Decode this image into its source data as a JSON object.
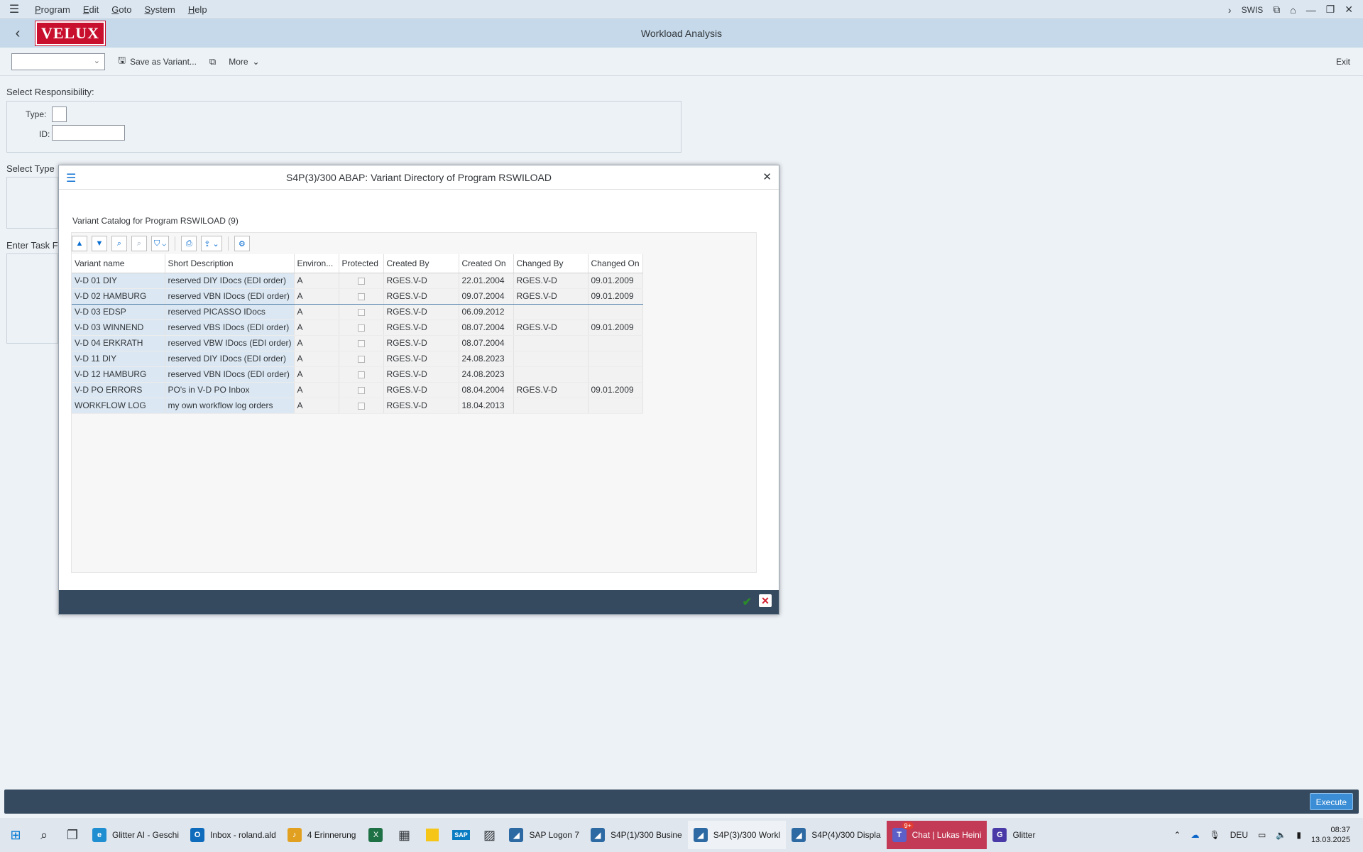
{
  "menubar": {
    "items": [
      "Program",
      "Edit",
      "Goto",
      "System",
      "Help"
    ],
    "system_id": "SWIS"
  },
  "titlebar": {
    "logo_text": "VELUX",
    "title": "Workload Analysis"
  },
  "toolbar": {
    "save_variant": "Save as Variant...",
    "more": "More",
    "exit": "Exit"
  },
  "main": {
    "select_responsibility": "Select Responsibility:",
    "type_label": "Type:",
    "id_label": "ID:",
    "select_type": "Select Type",
    "enter_task": "Enter Task F"
  },
  "dialog": {
    "title": "S4P(3)/300 ABAP: Variant Directory of Program RSWILOAD",
    "catalog_title": "Variant Catalog for Program RSWILOAD (9)",
    "columns": [
      "Variant name",
      "Short Description",
      "Environ...",
      "Protected",
      "Created By",
      "Created On",
      "Changed By",
      "Changed On"
    ],
    "rows": [
      {
        "name": "V-D 01 DIY",
        "desc": "reserved DIY IDocs (EDI order)",
        "env": "A",
        "created_by": "RGES.V-D",
        "created_on": "22.01.2004",
        "changed_by": "RGES.V-D",
        "changed_on": "09.01.2009"
      },
      {
        "name": "V-D 02 HAMBURG",
        "desc": "reserved VBN IDocs (EDI order)",
        "env": "A",
        "created_by": "RGES.V-D",
        "created_on": "09.07.2004",
        "changed_by": "RGES.V-D",
        "changed_on": "09.01.2009"
      },
      {
        "name": "V-D 03 EDSP",
        "desc": "reserved PICASSO IDocs",
        "env": "A",
        "created_by": "RGES.V-D",
        "created_on": "06.09.2012",
        "changed_by": "",
        "changed_on": ""
      },
      {
        "name": "V-D 03 WINNEND",
        "desc": "reserved VBS IDocs (EDI order)",
        "env": "A",
        "created_by": "RGES.V-D",
        "created_on": "08.07.2004",
        "changed_by": "RGES.V-D",
        "changed_on": "09.01.2009"
      },
      {
        "name": "V-D 04 ERKRATH",
        "desc": "reserved VBW IDocs (EDI order)",
        "env": "A",
        "created_by": "RGES.V-D",
        "created_on": "08.07.2004",
        "changed_by": "",
        "changed_on": ""
      },
      {
        "name": "V-D 11 DIY",
        "desc": "reserved DIY IDocs (EDI order)",
        "env": "A",
        "created_by": "RGES.V-D",
        "created_on": "24.08.2023",
        "changed_by": "",
        "changed_on": ""
      },
      {
        "name": "V-D 12 HAMBURG",
        "desc": "reserved VBN IDocs (EDI order)",
        "env": "A",
        "created_by": "RGES.V-D",
        "created_on": "24.08.2023",
        "changed_by": "",
        "changed_on": ""
      },
      {
        "name": "V-D PO ERRORS",
        "desc": "PO's in V-D PO Inbox",
        "env": "A",
        "created_by": "RGES.V-D",
        "created_on": "08.04.2004",
        "changed_by": "RGES.V-D",
        "changed_on": "09.01.2009"
      },
      {
        "name": "WORKFLOW LOG",
        "desc": "my own workflow log orders",
        "env": "A",
        "created_by": "RGES.V-D",
        "created_on": "18.04.2013",
        "changed_by": "",
        "changed_on": ""
      }
    ]
  },
  "statusbar": {
    "execute": "Execute"
  },
  "taskbar": {
    "apps": [
      {
        "label": "Glitter AI - Geschi",
        "icon": "edge-icon",
        "color": "#1f8fd1"
      },
      {
        "label": "Inbox - roland.ald",
        "icon": "outlook-icon",
        "color": "#0f6cbd"
      },
      {
        "label": "4 Erinnerung",
        "icon": "bell-icon",
        "color": "#e2a020"
      },
      {
        "label": "S4P(1)/300 Busine",
        "icon": "sap-gui-icon",
        "color": "#2d6aa3"
      },
      {
        "label": "S4P(3)/300 Workl",
        "icon": "sap-gui-icon",
        "color": "#2d6aa3"
      },
      {
        "label": "S4P(4)/300 Displa",
        "icon": "sap-gui-icon",
        "color": "#2d6aa3"
      },
      {
        "label": "Chat | Lukas Heini",
        "icon": "teams-icon",
        "color": "#5b5fc7"
      },
      {
        "label": "Glitter",
        "icon": "glitter-icon",
        "color": "#4a3aa8"
      }
    ],
    "sap_logon": "SAP Logon 7",
    "chat_badge": "9+",
    "lang": "DEU",
    "time": "08:37",
    "date": "13.03.2025"
  }
}
